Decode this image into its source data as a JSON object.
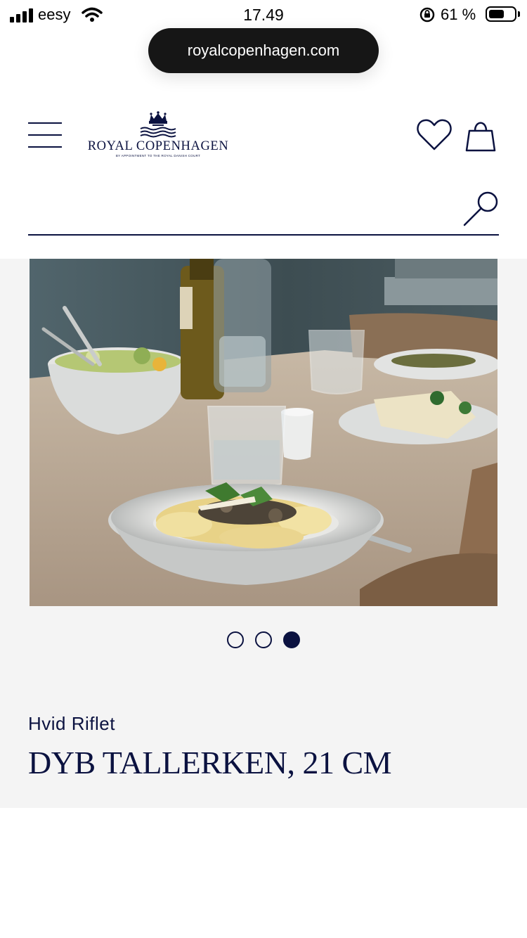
{
  "status_bar": {
    "carrier": "eesy",
    "time": "17.49",
    "battery_percent": "61 %",
    "battery_level": 0.61
  },
  "browser": {
    "url": "royalcopenhagen.com"
  },
  "header": {
    "logo_name": "ROYAL COPENHAGEN",
    "logo_subtitle": "BY APPOINTMENT TO THE ROYAL DANISH COURT",
    "menu_icon": "hamburger-icon",
    "wishlist_icon": "heart-icon",
    "cart_icon": "shopping-bag-icon"
  },
  "search": {
    "value": "",
    "placeholder": "",
    "icon": "search-icon"
  },
  "product": {
    "collection": "Hvid Riflet",
    "title": "DYB TALLERKEN, 21 CM",
    "carousel": {
      "count": 3,
      "active_index": 2
    }
  },
  "colors": {
    "brand_navy": "#0b1240",
    "panel_bg": "#f4f4f4"
  }
}
